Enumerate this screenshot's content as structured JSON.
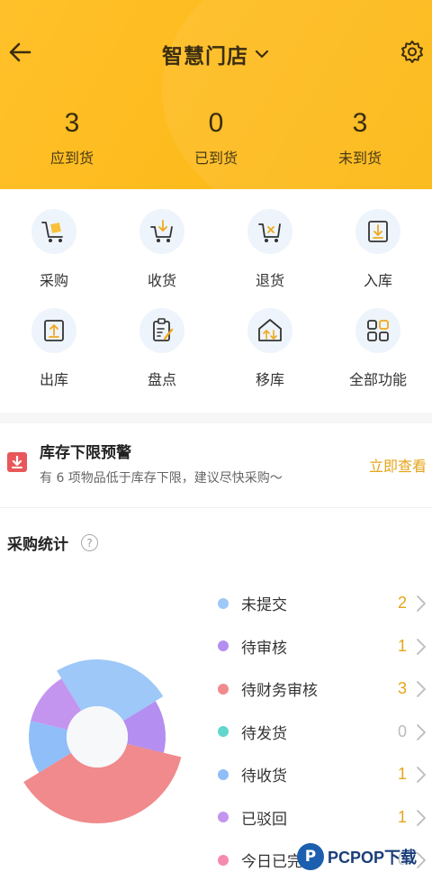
{
  "header": {
    "title": "智慧门店",
    "stats": [
      {
        "value": "3",
        "label": "应到货"
      },
      {
        "value": "0",
        "label": "已到货"
      },
      {
        "value": "3",
        "label": "未到货"
      }
    ]
  },
  "functions": [
    {
      "label": "采购",
      "icon": "cart-box-icon"
    },
    {
      "label": "收货",
      "icon": "cart-down-icon"
    },
    {
      "label": "退货",
      "icon": "cart-x-icon"
    },
    {
      "label": "入库",
      "icon": "inbox-down-icon"
    },
    {
      "label": "出库",
      "icon": "tray-up-icon"
    },
    {
      "label": "盘点",
      "icon": "clipboard-icon"
    },
    {
      "label": "移库",
      "icon": "warehouse-transfer-icon"
    },
    {
      "label": "全部功能",
      "icon": "grid-icon"
    }
  ],
  "alert": {
    "title": "库存下限预警",
    "desc": "有 6 项物品低于库存下限，建议尽快采购～",
    "link": "立即查看"
  },
  "stats_section": {
    "title": "采购统计",
    "help": "?"
  },
  "chart_data": {
    "type": "pie",
    "categories": [
      "未提交",
      "待审核",
      "待财务审核",
      "待发货",
      "待收货",
      "已驳回",
      "今日已完成"
    ],
    "values": [
      2,
      1,
      3,
      0,
      1,
      1,
      0
    ],
    "colors": [
      "#9dc8f8",
      "#b48ef0",
      "#f08a8c",
      "#63d6cd",
      "#8fbef8",
      "#c395ef",
      "#f48ab0"
    ]
  },
  "legend": [
    {
      "label": "未提交",
      "value": "2",
      "color": "#9dc8f8",
      "value_color": "#e6a41a"
    },
    {
      "label": "待审核",
      "value": "1",
      "color": "#b48ef0",
      "value_color": "#e6a41a"
    },
    {
      "label": "待财务审核",
      "value": "3",
      "color": "#f08a8c",
      "value_color": "#e6a41a"
    },
    {
      "label": "待发货",
      "value": "0",
      "color": "#63d6cd",
      "value_color": "#bbbbbb"
    },
    {
      "label": "待收货",
      "value": "1",
      "color": "#8fbef8",
      "value_color": "#e6a41a"
    },
    {
      "label": "已驳回",
      "value": "1",
      "color": "#c395ef",
      "value_color": "#e6a41a"
    },
    {
      "label": "今日已完成",
      "value": "0",
      "color": "#f48ab0",
      "value_color": "#bbbbbb"
    }
  ],
  "watermark": {
    "logo": "P",
    "text": "PCPOP下载"
  },
  "colors": {
    "header": "#fdbb1c",
    "accent": "#e6a41a",
    "icon_bg": "#eef4fb"
  }
}
